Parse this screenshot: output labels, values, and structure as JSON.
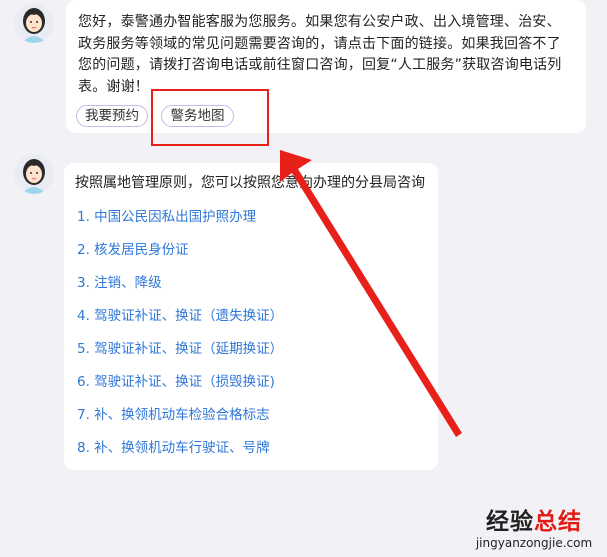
{
  "conversation": {
    "bot_message": {
      "text": "您好，泰警通办智能客服为您服务。如果您有公安户政、出入境管理、治安、政务服务等领域的常见问题需要咨询的，请点击下面的链接。如果我回答不了您的问题，请拨打咨询电话或前往窗口咨询，回复“人工服务”获取咨询电话列表。谢谢！",
      "quick_replies": [
        "我要预约",
        "警务地图"
      ]
    },
    "link_message": {
      "intro": "按照属地管理原则，您可以按照您意向办理的分县局咨询",
      "links": [
        "1. 中国公民因私出国护照办理",
        "2. 核发居民身份证",
        "3. 注销、降级",
        "4. 驾驶证补证、换证（遗失换证）",
        "5. 驾驶证补证、换证（延期换证）",
        "6. 驾驶证补证、换证（损毁换证)",
        "7. 补、换领机动车检验合格标志",
        "8. 补、换领机动车行驶证、号牌"
      ]
    }
  },
  "watermark": {
    "title_main": "经验",
    "title_accent": "总结",
    "url": "jingyanzongjie.com"
  },
  "colors": {
    "link": "#2f77d8",
    "annotation": "#e8201a",
    "chip_border": "#c9b8f0",
    "background": "#f2f2f6"
  }
}
